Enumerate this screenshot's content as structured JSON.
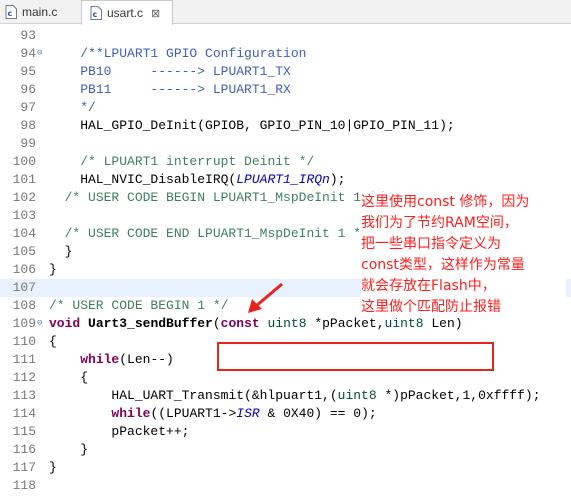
{
  "tabs": [
    {
      "label": "main.c",
      "active": false
    },
    {
      "label": "usart.c",
      "active": true,
      "close": "⊠"
    }
  ],
  "lines": [
    {
      "n": "93",
      "fold": "",
      "segs": [
        {
          "t": "",
          "c": ""
        }
      ]
    },
    {
      "n": "94",
      "fold": "⊖",
      "segs": [
        {
          "t": "    ",
          "c": ""
        },
        {
          "t": "/**LPUART1 GPIO Configuration",
          "c": "doc"
        }
      ]
    },
    {
      "n": "95",
      "fold": "",
      "segs": [
        {
          "t": "    ",
          "c": ""
        },
        {
          "t": "PB10     ------> LPUART1_TX",
          "c": "doc"
        }
      ]
    },
    {
      "n": "96",
      "fold": "",
      "segs": [
        {
          "t": "    ",
          "c": ""
        },
        {
          "t": "PB11     ------> LPUART1_RX",
          "c": "doc"
        }
      ]
    },
    {
      "n": "97",
      "fold": "",
      "segs": [
        {
          "t": "    ",
          "c": ""
        },
        {
          "t": "*/",
          "c": "doc"
        }
      ]
    },
    {
      "n": "98",
      "fold": "",
      "segs": [
        {
          "t": "    HAL_GPIO_DeInit(GPIOB, GPIO_PIN_10|GPIO_PIN_11);",
          "c": ""
        }
      ]
    },
    {
      "n": "99",
      "fold": "",
      "segs": [
        {
          "t": "",
          "c": ""
        }
      ]
    },
    {
      "n": "100",
      "fold": "",
      "segs": [
        {
          "t": "    ",
          "c": ""
        },
        {
          "t": "/* LPUART1 interrupt Deinit */",
          "c": "cm"
        }
      ]
    },
    {
      "n": "101",
      "fold": "",
      "segs": [
        {
          "t": "    HAL_NVIC_DisableIRQ(",
          "c": ""
        },
        {
          "t": "LPUART1_IRQn",
          "c": "it"
        },
        {
          "t": ");",
          "c": ""
        }
      ]
    },
    {
      "n": "102",
      "fold": "",
      "segs": [
        {
          "t": "  ",
          "c": ""
        },
        {
          "t": "/* USER CODE BEGIN LPUART1_MspDeInit 1 */",
          "c": "cm"
        }
      ]
    },
    {
      "n": "103",
      "fold": "",
      "segs": [
        {
          "t": "",
          "c": ""
        }
      ]
    },
    {
      "n": "104",
      "fold": "",
      "segs": [
        {
          "t": "  ",
          "c": ""
        },
        {
          "t": "/* USER CODE END LPUART1_MspDeInit 1 */",
          "c": "cm"
        }
      ]
    },
    {
      "n": "105",
      "fold": "",
      "segs": [
        {
          "t": "  }",
          "c": ""
        }
      ]
    },
    {
      "n": "106",
      "fold": "",
      "segs": [
        {
          "t": "}",
          "c": ""
        }
      ]
    },
    {
      "n": "107",
      "fold": "",
      "segs": [
        {
          "t": "",
          "c": ""
        }
      ]
    },
    {
      "n": "108",
      "fold": "",
      "segs": [
        {
          "t": "/* USER CODE BEGIN 1 */",
          "c": "cm"
        }
      ]
    },
    {
      "n": "109",
      "fold": "⊖",
      "segs": [
        {
          "t": "void",
          "c": "kw"
        },
        {
          "t": " ",
          "c": ""
        },
        {
          "t": "Uart3_sendBuffer",
          "c": "fn"
        },
        {
          "t": "(",
          "c": ""
        },
        {
          "t": "const",
          "c": "kw"
        },
        {
          "t": " ",
          "c": ""
        },
        {
          "t": "uint8",
          "c": "ty"
        },
        {
          "t": " *pPacket,",
          "c": ""
        },
        {
          "t": "uint8",
          "c": "ty"
        },
        {
          "t": " Len)",
          "c": ""
        }
      ]
    },
    {
      "n": "110",
      "fold": "",
      "segs": [
        {
          "t": "{",
          "c": ""
        }
      ]
    },
    {
      "n": "111",
      "fold": "",
      "segs": [
        {
          "t": "    ",
          "c": ""
        },
        {
          "t": "while",
          "c": "kw"
        },
        {
          "t": "(Len--)",
          "c": ""
        }
      ]
    },
    {
      "n": "112",
      "fold": "",
      "segs": [
        {
          "t": "    {",
          "c": ""
        }
      ]
    },
    {
      "n": "113",
      "fold": "",
      "segs": [
        {
          "t": "        HAL_UART_Transmit(&hlpuart1,(",
          "c": ""
        },
        {
          "t": "uint8",
          "c": "ty"
        },
        {
          "t": " *)pPacket,1,0xffff);",
          "c": ""
        }
      ]
    },
    {
      "n": "114",
      "fold": "",
      "segs": [
        {
          "t": "        ",
          "c": ""
        },
        {
          "t": "while",
          "c": "kw"
        },
        {
          "t": "((LPUART1->",
          "c": ""
        },
        {
          "t": "ISR",
          "c": "it"
        },
        {
          "t": " & 0X40) == 0);",
          "c": ""
        }
      ]
    },
    {
      "n": "115",
      "fold": "",
      "segs": [
        {
          "t": "        pPacket++;",
          "c": ""
        }
      ]
    },
    {
      "n": "116",
      "fold": "",
      "segs": [
        {
          "t": "    }",
          "c": ""
        }
      ]
    },
    {
      "n": "117",
      "fold": "",
      "segs": [
        {
          "t": "}",
          "c": ""
        }
      ]
    },
    {
      "n": "118",
      "fold": "",
      "segs": [
        {
          "t": "",
          "c": ""
        }
      ]
    }
  ],
  "annotation": {
    "lines": [
      "这里使用const 修饰，因为",
      "我们为了节约RAM空间，",
      "把一些串口指令定义为",
      "const类型，这样作为常量",
      "就会存放在Flash中，",
      "这里做个匹配防止报错"
    ],
    "color": "#ff1e1e"
  },
  "colors": {
    "comment": "#3f7f5f",
    "javadoc": "#3f5fbf",
    "keyword": "#7f0055",
    "highlight": "#e8f2fe"
  }
}
